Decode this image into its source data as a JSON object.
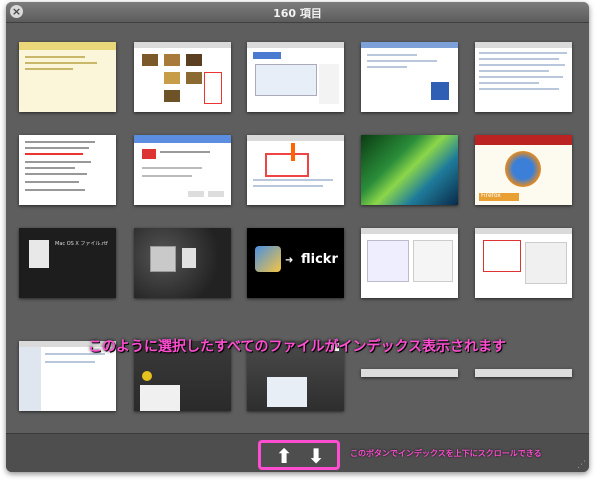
{
  "window": {
    "title": "160 項目"
  },
  "thumbnails": [
    {
      "name": "thumb-note-document",
      "kind": "note"
    },
    {
      "name": "thumb-photo-gallery",
      "kind": "gallery"
    },
    {
      "name": "thumb-google-search",
      "kind": "web"
    },
    {
      "name": "thumb-google-web-page",
      "kind": "web"
    },
    {
      "name": "thumb-web-page-dense",
      "kind": "web"
    },
    {
      "name": "thumb-context-menu",
      "kind": "menu"
    },
    {
      "name": "thumb-gmail-dialog",
      "kind": "dialog"
    },
    {
      "name": "thumb-web-annotated",
      "kind": "web"
    },
    {
      "name": "thumb-vista-wallpaper",
      "kind": "wallpaper"
    },
    {
      "name": "thumb-firefox-mozilla",
      "kind": "firefox"
    },
    {
      "name": "thumb-dark-text-file",
      "kind": "dark"
    },
    {
      "name": "thumb-dark-desktop",
      "kind": "darkdesk"
    },
    {
      "name": "thumb-iphoto-flickr",
      "kind": "flickr"
    },
    {
      "name": "thumb-preferences-window",
      "kind": "prefs"
    },
    {
      "name": "thumb-preferences-annotated",
      "kind": "prefs"
    },
    {
      "name": "thumb-finder-window",
      "kind": "finder"
    },
    {
      "name": "thumb-dark-panel",
      "kind": "darkpanel"
    },
    {
      "name": "thumb-dark-screen",
      "kind": "darkscreen"
    },
    {
      "name": "thumb-small-strip",
      "kind": "strip"
    },
    {
      "name": "thumb-small-strip-2",
      "kind": "strip"
    }
  ],
  "annotations": {
    "main": "このように選択したすべてのファイルがインデックス表示されます",
    "arrows": "このボタンでインデックスを上下にスクロールできる"
  },
  "labels": {
    "thumb_flickr": "flickr",
    "thumb_firefox": "Firefox",
    "thumb_dark_file": "Mac OS X ファイル.rtf",
    "thumb_menu_items": [
      "新しいタブ",
      "新しいウインドウ",
      "ページを開く",
      "保存",
      "印刷"
    ]
  },
  "colors": {
    "accent_pink": "#ff4dd2",
    "window_bg": "#5e5e5e"
  }
}
